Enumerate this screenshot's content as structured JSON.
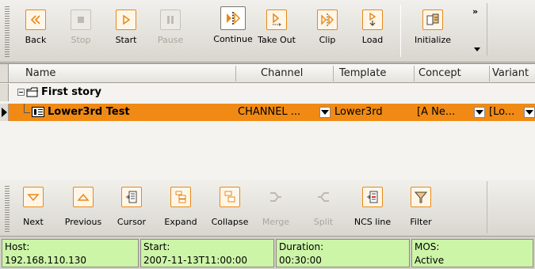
{
  "toolbar_top": {
    "buttons": [
      {
        "key": "back",
        "label": "Back",
        "icon": "rewind-icon",
        "enabled": true
      },
      {
        "key": "stop",
        "label": "Stop",
        "icon": "stop-icon",
        "enabled": false
      },
      {
        "key": "start",
        "label": "Start",
        "icon": "play-icon",
        "enabled": true
      },
      {
        "key": "pause",
        "label": "Pause",
        "icon": "pause-icon",
        "enabled": false
      },
      {
        "key": "continue",
        "label": "Continue",
        "icon": "continue-icon",
        "enabled": true
      },
      {
        "key": "takeout",
        "label": "Take Out",
        "icon": "take-out-icon",
        "enabled": true
      },
      {
        "key": "clip",
        "label": "Clip",
        "icon": "clip-icon",
        "enabled": true
      },
      {
        "key": "load",
        "label": "Load",
        "icon": "load-icon",
        "enabled": true
      },
      {
        "key": "initialize",
        "label": "Initialize",
        "icon": "initialize-icon",
        "enabled": true
      }
    ],
    "more_glyph": "»"
  },
  "grid": {
    "columns": [
      "Name",
      "Channel",
      "Template",
      "Concept",
      "Variant"
    ],
    "story": {
      "name": "First story"
    },
    "item": {
      "name": "Lower3rd Test",
      "channel": "CHANNEL ...",
      "template": "Lower3rd",
      "concept": "[A Ne...",
      "variant": "[Lo..."
    }
  },
  "toolbar_bottom": {
    "buttons": [
      {
        "key": "next",
        "label": "Next",
        "icon": "next-icon",
        "enabled": true
      },
      {
        "key": "previous",
        "label": "Previous",
        "icon": "previous-icon",
        "enabled": true
      },
      {
        "key": "cursor",
        "label": "Cursor",
        "icon": "cursor-icon",
        "enabled": true
      },
      {
        "key": "expand",
        "label": "Expand",
        "icon": "expand-icon",
        "enabled": true
      },
      {
        "key": "collapse",
        "label": "Collapse",
        "icon": "collapse-icon",
        "enabled": true
      },
      {
        "key": "merge",
        "label": "Merge",
        "icon": "merge-icon",
        "enabled": false
      },
      {
        "key": "split",
        "label": "Split",
        "icon": "split-icon",
        "enabled": false
      },
      {
        "key": "ncsline",
        "label": "NCS line",
        "icon": "ncs-line-icon",
        "enabled": true
      },
      {
        "key": "filter",
        "label": "Filter",
        "icon": "filter-icon",
        "enabled": true
      }
    ]
  },
  "status": {
    "host_label": "Host:",
    "host_value": "192.168.110.130",
    "start_label": "Start:",
    "start_value": "2007-11-13T11:00:00",
    "duration_label": "Duration:",
    "duration_value": "00:30:00",
    "mos_label": "MOS:",
    "mos_value": "Active"
  },
  "colors": {
    "accent": "#f08a14",
    "status_bg": "#ccf5a8",
    "icon_border": "#e58a19"
  }
}
